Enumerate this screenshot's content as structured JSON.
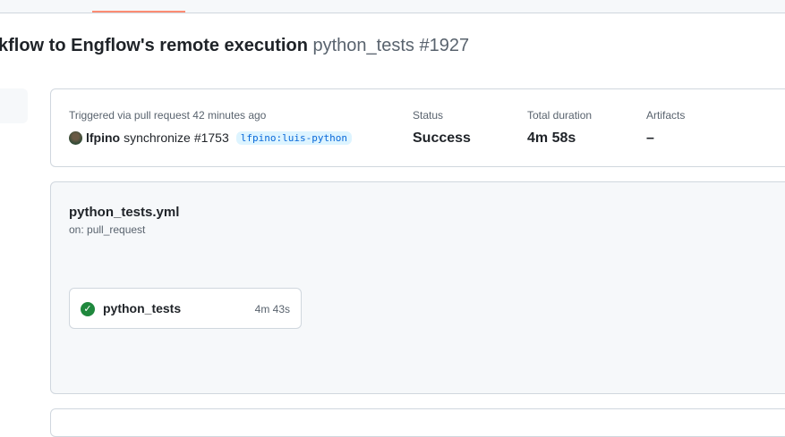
{
  "header": {
    "title": "kflow to Engflow's remote execution",
    "workflow_name": "python_tests",
    "run_number": "#1927"
  },
  "summary": {
    "trigger": "Triggered via pull request 42 minutes ago",
    "actor": "lfpino",
    "event": "synchronize",
    "pr": "#1753",
    "branch": "lfpino:luis-python",
    "status_label": "Status",
    "status_value": "Success",
    "duration_label": "Total duration",
    "duration_value": "4m 58s",
    "artifacts_label": "Artifacts",
    "artifacts_value": "–"
  },
  "workflow": {
    "file": "python_tests.yml",
    "on": "on: pull_request",
    "jobs": [
      {
        "name": "python_tests",
        "duration": "4m 43s",
        "status": "success"
      }
    ]
  },
  "colors": {
    "success": "#1f883d",
    "tab_underline": "#fd8c73"
  }
}
